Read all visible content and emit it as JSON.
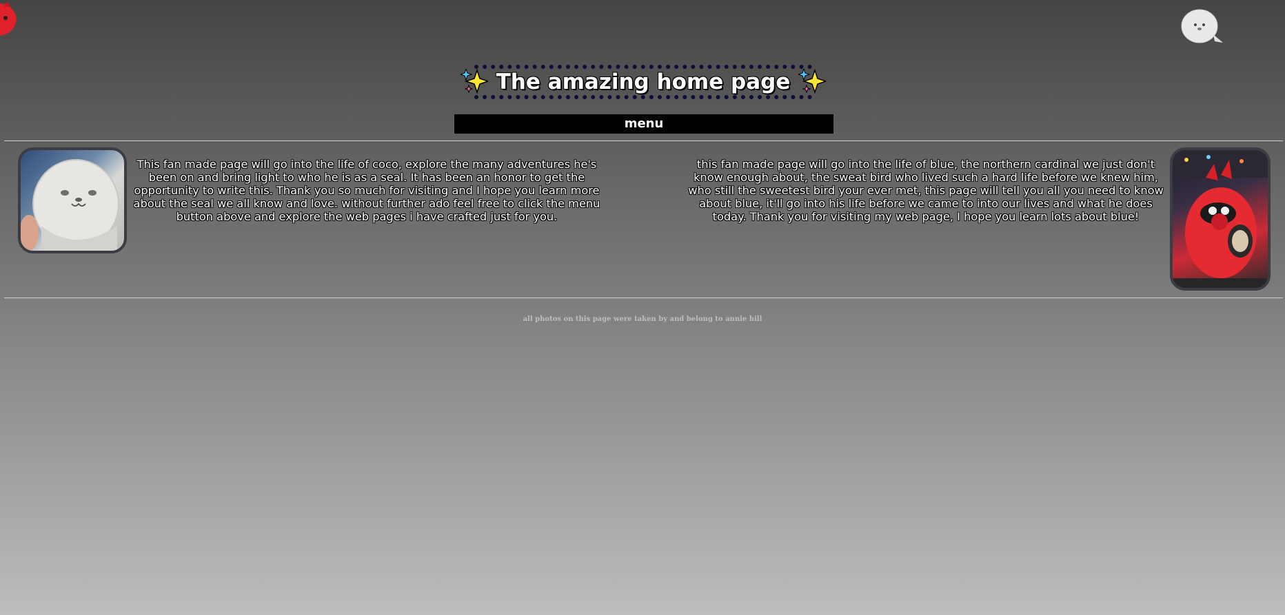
{
  "header": {
    "title": "The amazing home page",
    "title_icon": "sparkles-icon"
  },
  "nav": {
    "menu_label": "menu"
  },
  "main": {
    "coco_blurb": "This fan made page will go into the life of coco, explore the many adventures he's been on and bring light to who he is as a seal. It has been an honor to get the opportunity to write this. Thank you so much for visiting and I hope you learn more about the seal we all know and love. without further ado feel free to click the menu button above and explore the web pages i have crafted just for you.",
    "blue_blurb": "this fan made page will go into the life of blue, the northern cardinal we just don't know enough about, the sweat bird who lived such a hard life before we knew him, who still the sweetest bird your ever met, this page will tell you all you need to know about blue, it'll go into his life before we came to into our lives and what he does today. Thank you for visiting my web page, I hope you learn lots about blue!"
  },
  "footer": {
    "credit": "all photos on this page were taken by and belong to annie hill"
  },
  "colors": {
    "title_border": "#0d0d3a",
    "menu_bg": "#000000",
    "photo_frame": "#3c3c44"
  }
}
